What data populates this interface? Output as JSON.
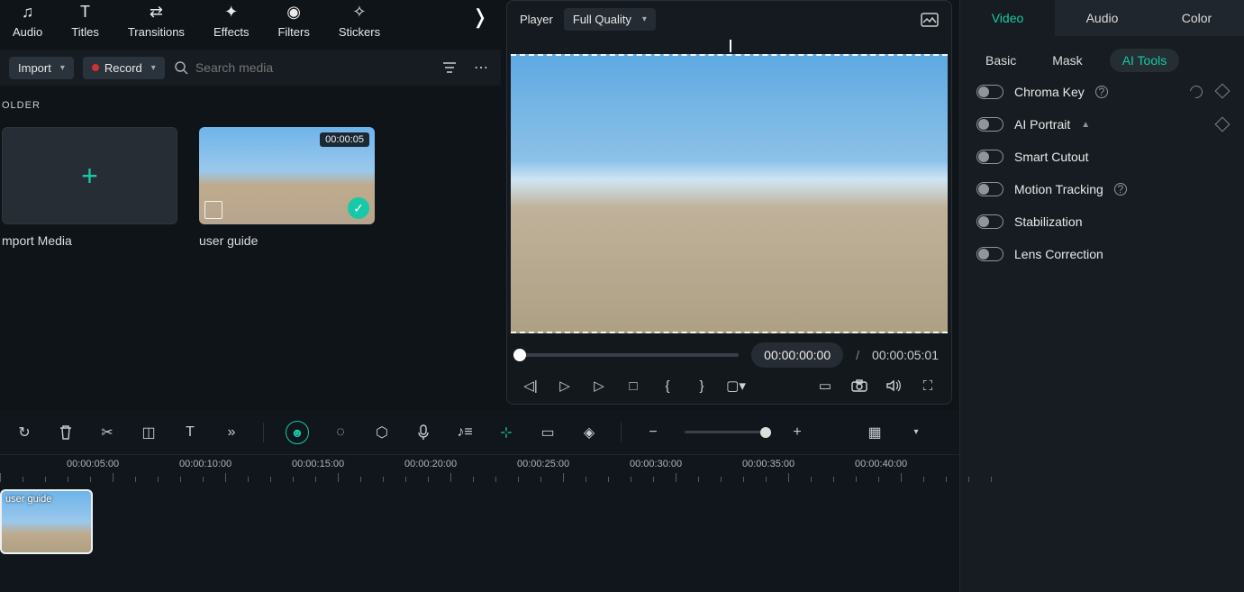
{
  "topbar": {
    "items": [
      {
        "icon": "audio",
        "label": "Audio"
      },
      {
        "icon": "titles",
        "label": "Titles"
      },
      {
        "icon": "transitions",
        "label": "Transitions"
      },
      {
        "icon": "effects",
        "label": "Effects"
      },
      {
        "icon": "filters",
        "label": "Filters"
      },
      {
        "icon": "stickers",
        "label": "Stickers"
      }
    ]
  },
  "mediabar": {
    "import_label": "Import",
    "record_label": "Record",
    "search_placeholder": "Search media"
  },
  "folder_header": "OLDER",
  "media": {
    "import_tile_label": "mport Media",
    "clip": {
      "label": "user guide",
      "duration": "00:00:05"
    }
  },
  "player": {
    "title": "Player",
    "quality_label": "Full Quality",
    "current_time": "00:00:00:00",
    "separator": "/",
    "total_time": "00:00:05:01"
  },
  "rightpanel": {
    "tabs": [
      "Video",
      "Audio",
      "Color"
    ],
    "active_tab": 0,
    "subtabs": [
      "Basic",
      "Mask",
      "AI Tools"
    ],
    "active_subtab": 2,
    "props": [
      {
        "label": "Chroma Key",
        "hint": true,
        "undo": true,
        "key": true
      },
      {
        "label": "AI Portrait",
        "hint": false,
        "caret": true,
        "key": true
      },
      {
        "label": "Smart Cutout",
        "hint": false
      },
      {
        "label": "Motion Tracking",
        "hint": true
      },
      {
        "label": "Stabilization",
        "hint": false
      },
      {
        "label": "Lens Correction",
        "hint": false
      }
    ]
  },
  "timeline": {
    "stamps": [
      "00:00:05:00",
      "00:00:10:00",
      "00:00:15:00",
      "00:00:20:00",
      "00:00:25:00",
      "00:00:30:00",
      "00:00:35:00",
      "00:00:40:00"
    ],
    "clip_label": "user guide"
  }
}
